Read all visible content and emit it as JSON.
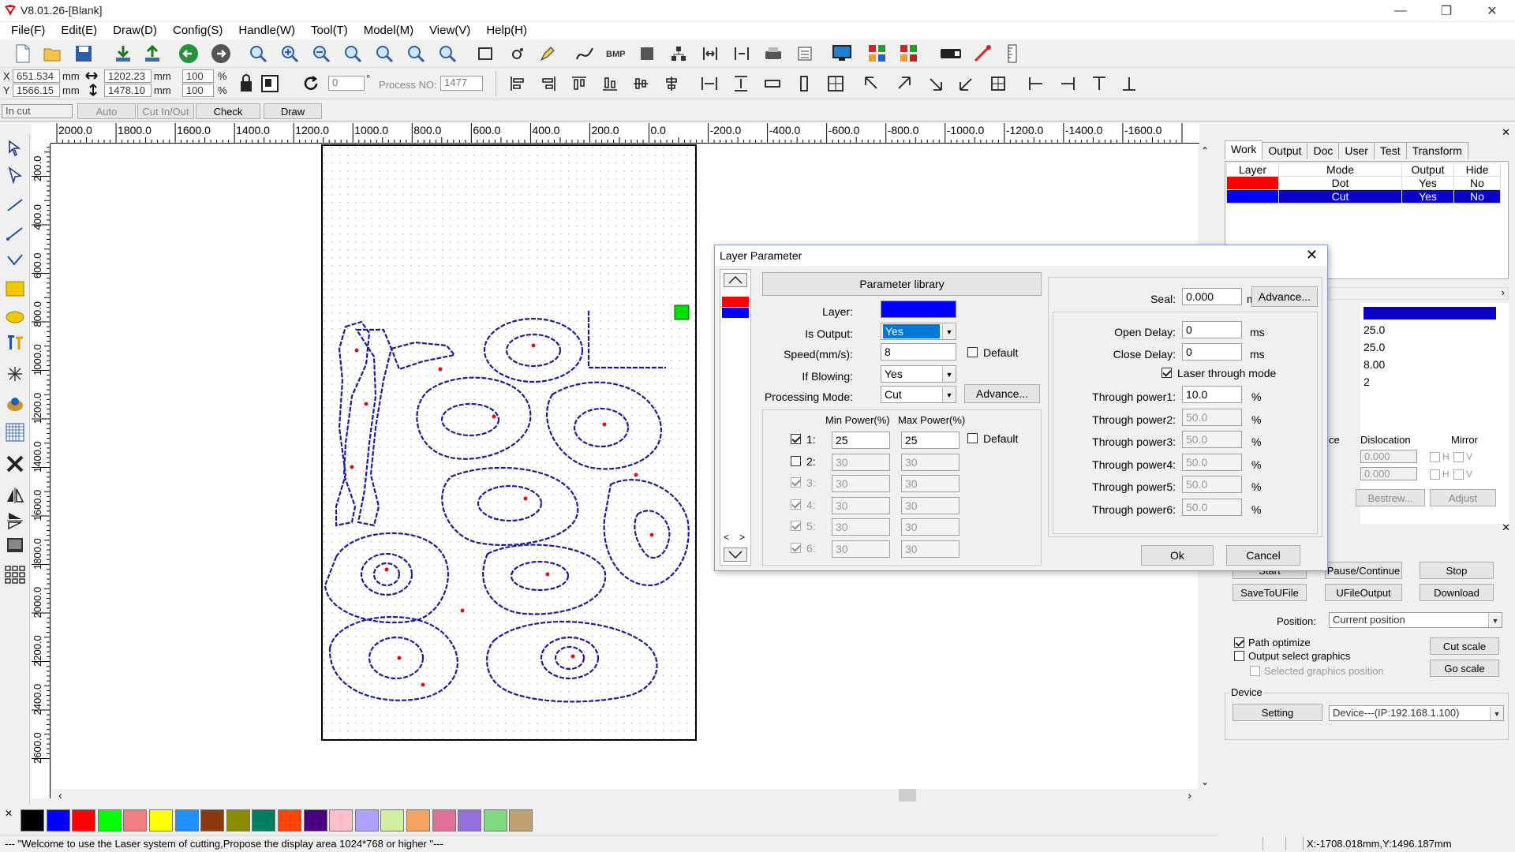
{
  "window": {
    "title": "V8.01.26-[Blank]"
  },
  "menu": [
    "File(F)",
    "Edit(E)",
    "Draw(D)",
    "Config(S)",
    "Handle(W)",
    "Tool(T)",
    "Model(M)",
    "View(V)",
    "Help(H)"
  ],
  "coords": {
    "x_label": "X",
    "y_label": "Y",
    "x": "651.534",
    "y": "1566.15",
    "unit": "mm",
    "w": "1202.23",
    "h": "1478.10",
    "pct_w": "100",
    "pct_h": "100",
    "pct": "%",
    "angle": "0",
    "deg": "°",
    "process_label": "Process NO:",
    "process_no": "1477"
  },
  "toolbar3": {
    "mode": "In cut",
    "auto": "Auto",
    "cut_inout": "Cut In/Out",
    "check": "Check",
    "draw": "Draw"
  },
  "ruler_h": [
    "2000.0",
    "1800.0",
    "1600.0",
    "1400.0",
    "1200.0",
    "1000.0",
    "800.0",
    "600.0",
    "400.0",
    "200.0",
    "0.0",
    "-200.0",
    "-400.0",
    "-600.0",
    "-800.0",
    "-1000.0",
    "-1200.0",
    "-1400.0",
    "-1600.0"
  ],
  "ruler_v": [
    "200.0",
    "400.0",
    "600.0",
    "800.0",
    "1000.0",
    "1200.0",
    "1400.0",
    "1600.0",
    "1800.0",
    "2000.0",
    "2200.0",
    "2400.0",
    "2600.0"
  ],
  "palette": [
    "#000000",
    "#0000ff",
    "#ff0000",
    "#00ff00",
    "#f08080",
    "#ffff00",
    "#1e90ff",
    "#8b3a0e",
    "#8b8b00",
    "#008060",
    "#ff4500",
    "#4b0082",
    "#ffc0cb",
    "#b0a0ff",
    "#d0f0a0",
    "#f4a460",
    "#e0709a",
    "#9370db",
    "#80d880",
    "#c0a070"
  ],
  "status": {
    "message": "--- \"Welcome to use the Laser system of cutting,Propose the display area 1024*768 or higher \"---",
    "coords": "X:-1708.018mm,Y:1496.187mm"
  },
  "panel": {
    "tabs": [
      "Work",
      "Output",
      "Doc",
      "User",
      "Test",
      "Transform"
    ],
    "headers": [
      "Layer",
      "Mode",
      "Output",
      "Hide"
    ],
    "layers": [
      {
        "color": "#ff0000",
        "mode": "Dot",
        "output": "Yes",
        "hide": "No"
      },
      {
        "color": "#0000ff",
        "mode": "Cut",
        "output": "Yes",
        "hide": "No"
      }
    ],
    "values": [
      "25.0",
      "25.0",
      "8.00",
      "2"
    ],
    "partial_ce": "ce",
    "dislocation": "Dislocation",
    "mirror": "Mirror",
    "disloc_vals": [
      "0.000",
      "0.000"
    ],
    "h": "H",
    "v": "V",
    "bestrew": "Bestrew...",
    "adjust": "Adjust",
    "start": "Start",
    "pause": "Pause/Continue",
    "stop": "Stop",
    "savetofile": "SaveToUFile",
    "ufileoutput": "UFileOutput",
    "download": "Download",
    "position_label": "Position:",
    "position_value": "Current position",
    "path_optimize": "Path optimize",
    "output_select": "Output select graphics",
    "selected_pos": "Selected graphics position",
    "cut_scale": "Cut scale",
    "go_scale": "Go scale",
    "device_group": "Device",
    "setting": "Setting",
    "device_value": "Device---(IP:192.168.1.100)"
  },
  "dialog": {
    "title": "Layer Parameter",
    "param_library": "Parameter library",
    "layer_label": "Layer:",
    "layer_color": "#0000ff",
    "is_output_label": "Is Output:",
    "is_output": "Yes",
    "speed_label": "Speed(mm/s):",
    "speed": "8",
    "default": "Default",
    "blowing_label": "If Blowing:",
    "blowing": "Yes",
    "mode_label": "Processing Mode:",
    "mode": "Cut",
    "advance": "Advance...",
    "min_power": "Min Power(%)",
    "max_power": "Max Power(%)",
    "powers": [
      {
        "n": "1:",
        "min": "25",
        "max": "25"
      },
      {
        "n": "2:",
        "min": "30",
        "max": "30"
      },
      {
        "n": "3:",
        "min": "30",
        "max": "30"
      },
      {
        "n": "4:",
        "min": "30",
        "max": "30"
      },
      {
        "n": "5:",
        "min": "30",
        "max": "30"
      },
      {
        "n": "6:",
        "min": "30",
        "max": "30"
      }
    ],
    "seal_label": "Seal:",
    "seal": "0.000",
    "mm": "mm",
    "open_delay_label": "Open Delay:",
    "open_delay": "0",
    "close_delay_label": "Close Delay:",
    "close_delay": "0",
    "ms": "ms",
    "laser_through": "Laser through mode",
    "through": [
      {
        "label": "Through power1:",
        "v": "10.0"
      },
      {
        "label": "Through power2:",
        "v": "50.0"
      },
      {
        "label": "Through power3:",
        "v": "50.0"
      },
      {
        "label": "Through power4:",
        "v": "50.0"
      },
      {
        "label": "Through power5:",
        "v": "50.0"
      },
      {
        "label": "Through power6:",
        "v": "50.0"
      }
    ],
    "pct": "%",
    "ok": "Ok",
    "cancel": "Cancel"
  }
}
